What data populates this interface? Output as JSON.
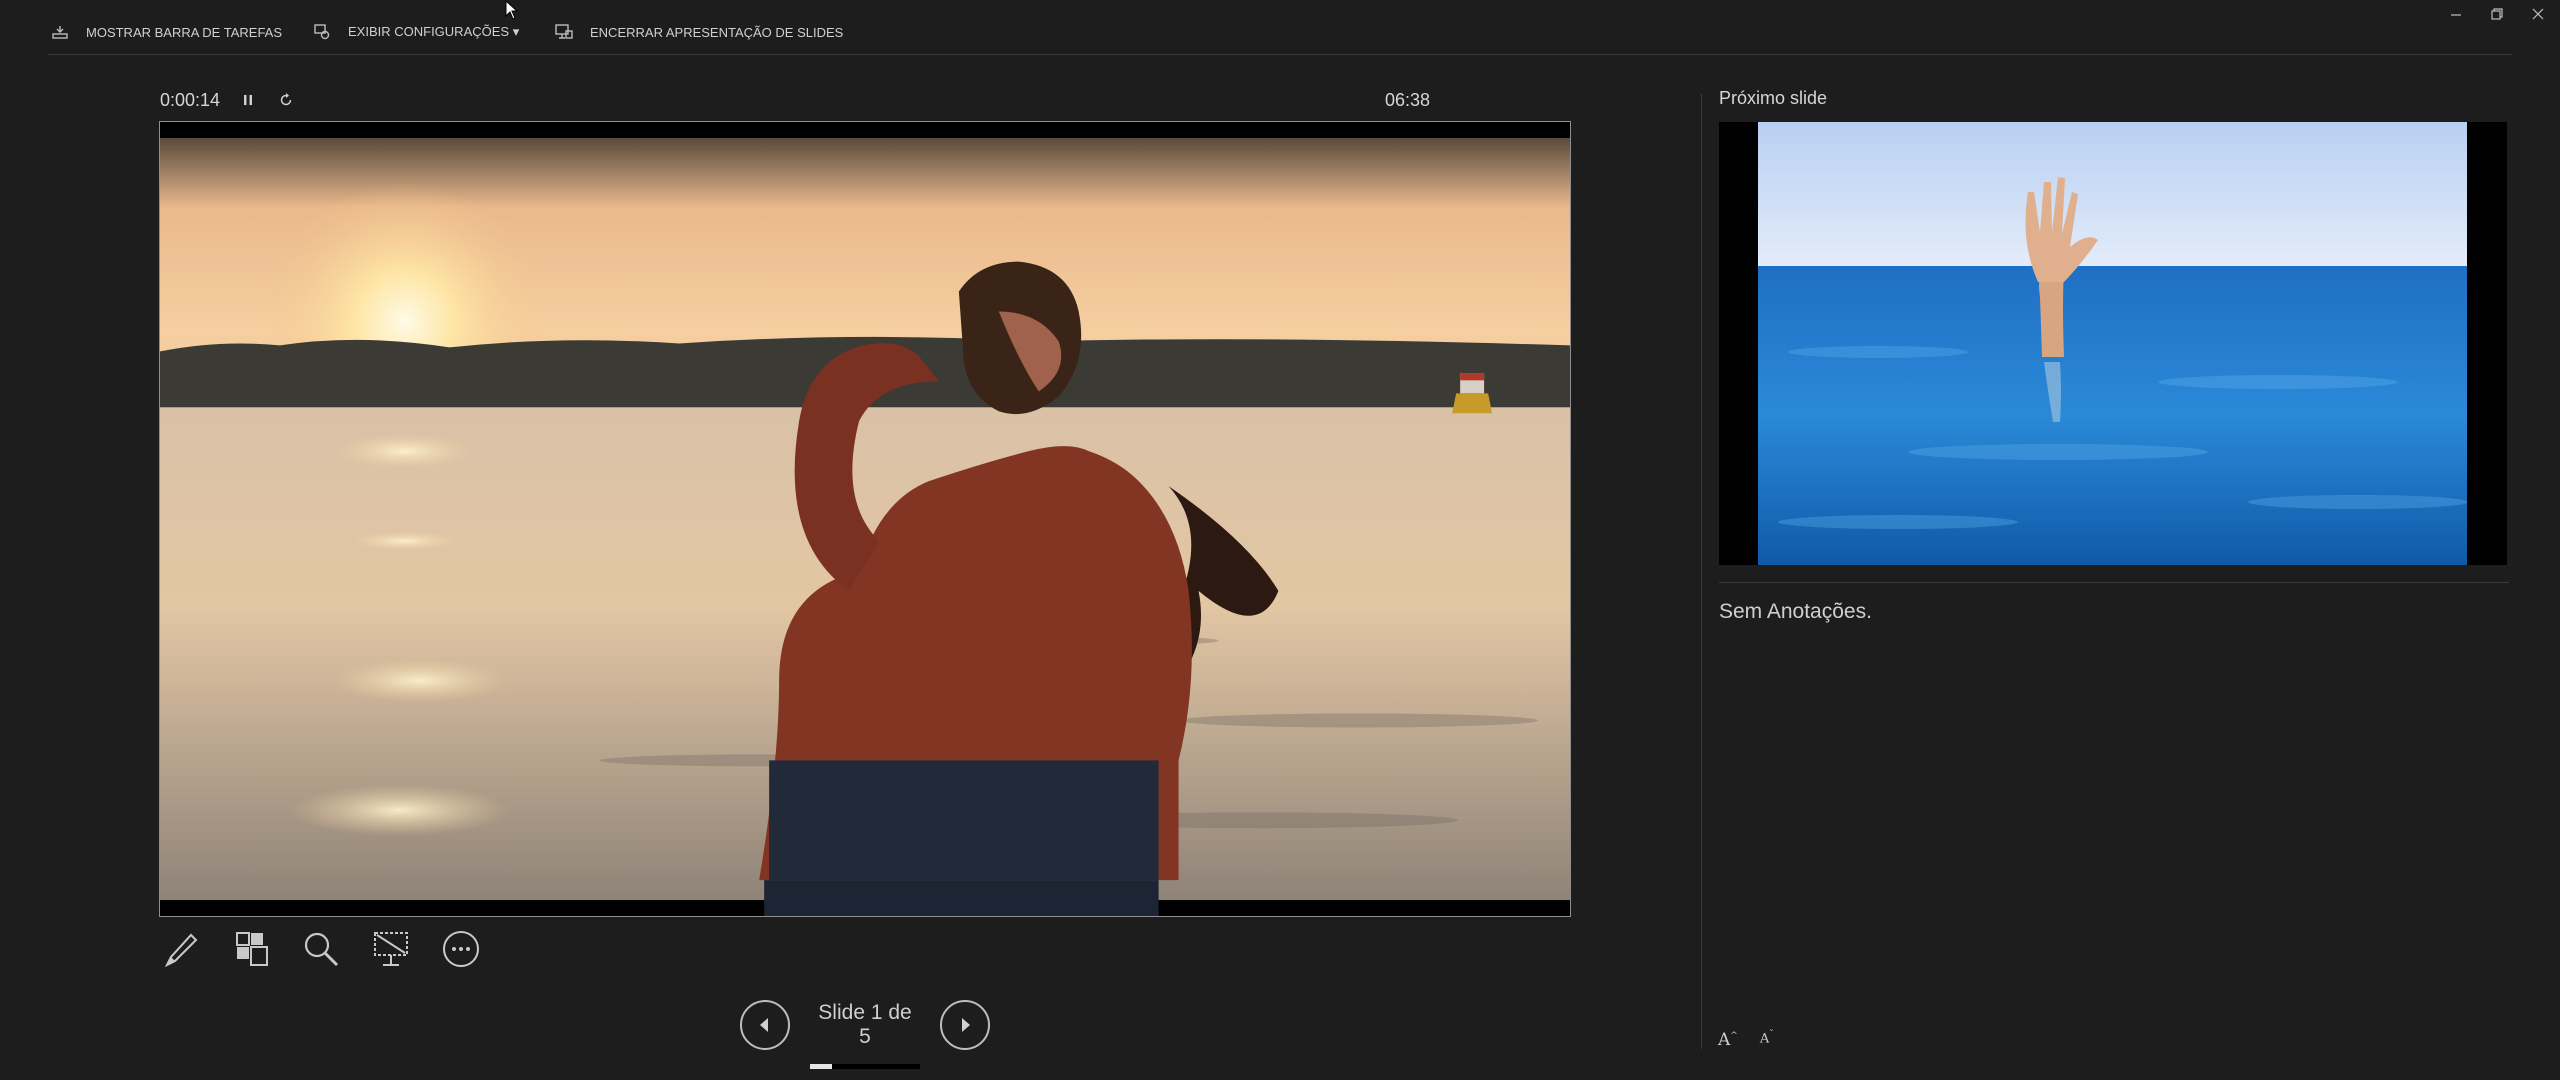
{
  "toolbar": {
    "show_taskbar": "MOSTRAR BARRA DE TAREFAS",
    "display_settings": "EXIBIR CONFIGURAÇÕES ▾",
    "end_slideshow": "ENCERRAR APRESENTAÇÃO DE SLIDES"
  },
  "timer": {
    "elapsed": "0:00:14",
    "clock": "06:38"
  },
  "current_slide": {
    "image": "woman-standing-in-lake-at-sunset"
  },
  "tools": [
    "pen-icon",
    "see-all-slides-icon",
    "zoom-icon",
    "black-screen-icon",
    "more-options-icon"
  ],
  "navigation": {
    "counter": "Slide 1 de 5",
    "current": 1,
    "total": 5,
    "progress_fraction": 0.2
  },
  "next_slide": {
    "label": "Próximo slide",
    "image": "hand-reaching-out-of-sea"
  },
  "notes": {
    "text": "Sem Anotações."
  },
  "font_size": {
    "increase": "A",
    "decrease": "A"
  },
  "colors": {
    "background": "#1d1d1d",
    "text": "#d2d2d2",
    "divider": "#3a3a3a"
  }
}
